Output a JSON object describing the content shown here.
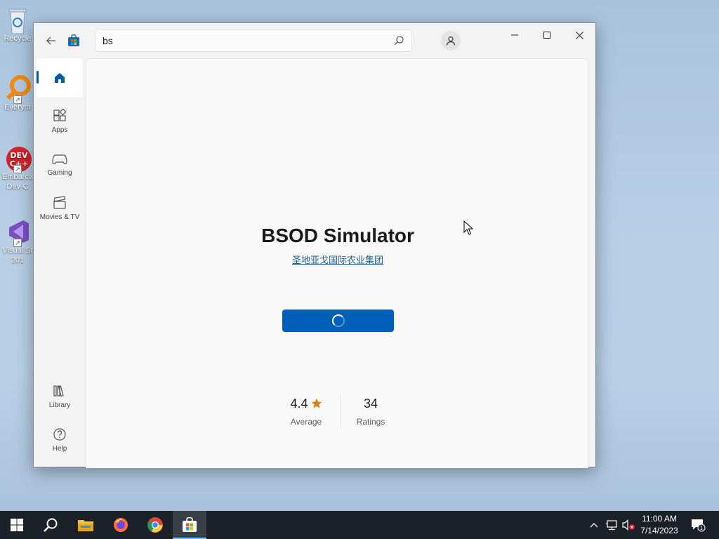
{
  "desktop": {
    "icons": [
      {
        "label": "Recycle",
        "icon": "recycle-bin-icon"
      },
      {
        "label": "Everyth",
        "icon": "everything-search-icon"
      },
      {
        "label": "Embarca",
        "label2": "Dev-C",
        "icon": "devcpp-icon"
      },
      {
        "label": "Visual St",
        "label2": "201",
        "icon": "visual-studio-icon"
      }
    ]
  },
  "window": {
    "search": {
      "value": "bs"
    },
    "controls": {
      "minimize": "minimize-icon",
      "maximize": "maximize-icon",
      "close": "close-icon"
    }
  },
  "sidebar": {
    "items": [
      {
        "label": "",
        "icon": "home-icon",
        "active": true
      },
      {
        "label": "Apps",
        "icon": "apps-icon"
      },
      {
        "label": "Gaming",
        "icon": "gamepad-icon"
      },
      {
        "label": "Movies & TV",
        "icon": "clapperboard-icon"
      },
      {
        "label": "Library",
        "icon": "library-icon"
      },
      {
        "label": "Help",
        "icon": "help-icon"
      }
    ]
  },
  "app": {
    "title": "BSOD Simulator",
    "publisher": "圣地亚戈国际农业集团",
    "install_state": "loading",
    "rating": {
      "value": "4.4",
      "label": "Average",
      "star_color": "#d67f0e"
    },
    "ratings_count": {
      "value": "34",
      "label": "Ratings"
    }
  },
  "taskbar": {
    "apps": [
      "start-icon",
      "search-icon",
      "file-explorer-icon",
      "firefox-icon",
      "chrome-icon",
      "microsoft-store-icon"
    ],
    "active_app": "microsoft-store-icon",
    "clock": {
      "time": "11:00 AM",
      "date": "7/14/2023"
    },
    "notification_count": "1"
  },
  "colors": {
    "accent": "#005fb8",
    "taskbar": "#1c2129",
    "link": "#1e5e8c"
  }
}
